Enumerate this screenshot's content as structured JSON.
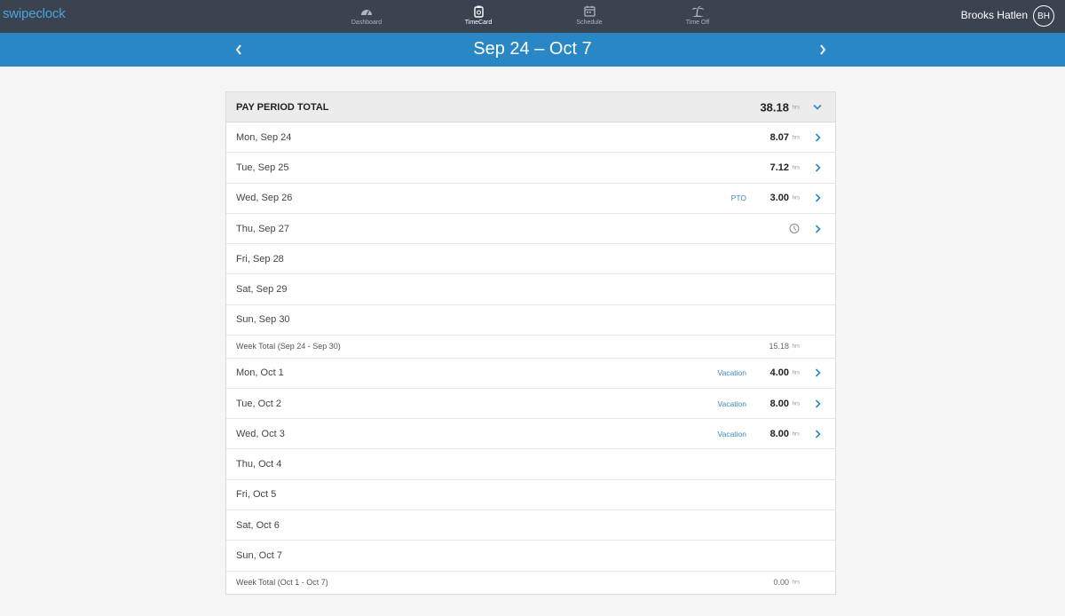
{
  "app": {
    "logo": "swipeclock"
  },
  "nav": [
    {
      "label": "Dashboard",
      "icon": "dashboard-icon",
      "active": false
    },
    {
      "label": "TimeCard",
      "icon": "timecard-icon",
      "active": true
    },
    {
      "label": "Schedule",
      "icon": "schedule-icon",
      "active": false
    },
    {
      "label": "Time Off",
      "icon": "time-off-icon",
      "active": false
    }
  ],
  "user": {
    "name": "Brooks Hatlen",
    "initials": "BH"
  },
  "period": {
    "title": "Sep 24 – Oct 7"
  },
  "pay_total": {
    "label": "PAY PERIOD TOTAL",
    "hours": "38.18",
    "unit": "hrs"
  },
  "days": [
    {
      "label": "Mon, Sep 24",
      "code": "",
      "hours": "8.07",
      "unit": "hrs",
      "chevron": true,
      "clock": false
    },
    {
      "label": "Tue, Sep 25",
      "code": "",
      "hours": "7.12",
      "unit": "hrs",
      "chevron": true,
      "clock": false
    },
    {
      "label": "Wed, Sep 26",
      "code": "PTO",
      "hours": "3.00",
      "unit": "hrs",
      "chevron": true,
      "clock": false
    },
    {
      "label": "Thu, Sep 27",
      "code": "",
      "hours": "",
      "unit": "",
      "chevron": true,
      "clock": true
    },
    {
      "label": "Fri, Sep 28",
      "code": "",
      "hours": "",
      "unit": "",
      "chevron": false,
      "clock": false
    },
    {
      "label": "Sat, Sep 29",
      "code": "",
      "hours": "",
      "unit": "",
      "chevron": false,
      "clock": false
    },
    {
      "label": "Sun, Sep 30",
      "code": "",
      "hours": "",
      "unit": "",
      "chevron": false,
      "clock": false
    }
  ],
  "week1_total": {
    "label": "Week Total (Sep 24 - Sep 30)",
    "hours": "15.18",
    "unit": "hrs"
  },
  "days2": [
    {
      "label": "Mon, Oct 1",
      "code": "Vacation",
      "hours": "4.00",
      "unit": "hrs",
      "chevron": true,
      "clock": false
    },
    {
      "label": "Tue, Oct 2",
      "code": "Vacation",
      "hours": "8.00",
      "unit": "hrs",
      "chevron": true,
      "clock": false
    },
    {
      "label": "Wed, Oct 3",
      "code": "Vacation",
      "hours": "8.00",
      "unit": "hrs",
      "chevron": true,
      "clock": false
    },
    {
      "label": "Thu, Oct 4",
      "code": "",
      "hours": "",
      "unit": "",
      "chevron": false,
      "clock": false
    },
    {
      "label": "Fri, Oct 5",
      "code": "",
      "hours": "",
      "unit": "",
      "chevron": false,
      "clock": false
    },
    {
      "label": "Sat, Oct 6",
      "code": "",
      "hours": "",
      "unit": "",
      "chevron": false,
      "clock": false
    },
    {
      "label": "Sun, Oct 7",
      "code": "",
      "hours": "",
      "unit": "",
      "chevron": false,
      "clock": false
    }
  ],
  "week2_total": {
    "label": "Week Total (Oct 1 - Oct 7)",
    "hours": "0.00",
    "unit": "hrs"
  },
  "colors": {
    "topbar": "#3b4350",
    "datebar": "#2a87c6",
    "accent": "#3d8ac5",
    "logo": "#4aa3df"
  }
}
